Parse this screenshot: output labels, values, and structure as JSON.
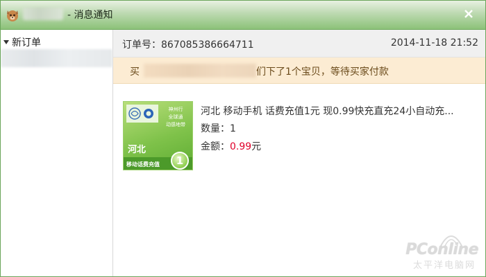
{
  "window": {
    "title": "- 消息通知",
    "close_icon": "close-icon",
    "accent_color": "#8cc279"
  },
  "sidebar": {
    "section_label": "新订单"
  },
  "order": {
    "number_label": "订单号：867085386664711",
    "time": "2014-11-18 21:52",
    "notice_prefix": "买",
    "notice_text": "们下了1个宝贝，等待买家付款",
    "notice_bg_color": "#fcecd3"
  },
  "product": {
    "title": "河北 移动手机 话费充值1元 现0.99快充直充24小自动充...",
    "quantity_label": "数量：1",
    "amount_label": "金额：",
    "amount_value": "0.99",
    "amount_unit": "元",
    "price_color": "#e0002a",
    "image": {
      "slogan_line1": "神州行",
      "slogan_line2": "全球通",
      "slogan_line3": "动感地带",
      "region": "河北",
      "card_label": "移动话费充值",
      "denomination": "1"
    }
  },
  "watermark": {
    "brand": "PConline",
    "sub": "太平洋电脑网"
  }
}
